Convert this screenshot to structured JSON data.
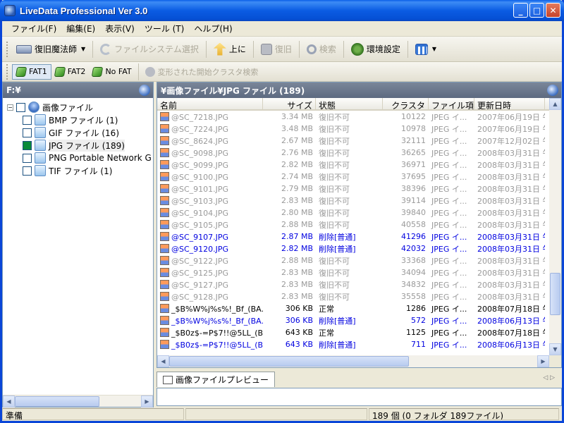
{
  "window": {
    "title": "LiveData Professional Ver 3.0"
  },
  "menu": [
    "ファイル(F)",
    "編集(E)",
    "表示(V)",
    "ツール (T)",
    "ヘルプ(H)"
  ],
  "toolbar1": {
    "restore_wizard": "復旧魔法師",
    "fs_select": "ファイルシステム選択",
    "up": "上に",
    "restore": "復旧",
    "search": "検索",
    "settings": "環境設定"
  },
  "toolbar2": {
    "fat1": "FAT1",
    "fat2": "FAT2",
    "nofat": "No FAT",
    "cluster_search": "変形された開始クラスタ検索"
  },
  "left": {
    "header": "F:¥",
    "root": "画像ファイル",
    "items": [
      "BMP ファイル (1)",
      "GIF ファイル (16)",
      "JPG ファイル (189)",
      "PNG Portable Network G",
      "TIF ファイル (1)"
    ]
  },
  "right": {
    "header": "¥画像ファイル¥JPG ファイル (189)",
    "columns": [
      "名前",
      "サイズ",
      "状態",
      "クラスタ",
      "ファイル項...",
      "更新日時"
    ],
    "rows": [
      {
        "name": "@SC_7218.JPG",
        "size": "3.34 MB",
        "state": "復旧不可",
        "cluster": "10122",
        "type": "JPEG イ...",
        "date": "2007年06月19日  午",
        "style": "gray"
      },
      {
        "name": "@SC_7224.JPG",
        "size": "3.48 MB",
        "state": "復旧不可",
        "cluster": "10978",
        "type": "JPEG イ...",
        "date": "2007年06月19日  午",
        "style": "gray"
      },
      {
        "name": "@SC_8624.JPG",
        "size": "2.67 MB",
        "state": "復旧不可",
        "cluster": "32111",
        "type": "JPEG イ...",
        "date": "2007年12月02日  午",
        "style": "gray"
      },
      {
        "name": "@SC_9098.JPG",
        "size": "2.76 MB",
        "state": "復旧不可",
        "cluster": "36265",
        "type": "JPEG イ...",
        "date": "2008年03月31日  午",
        "style": "gray"
      },
      {
        "name": "@SC_9099.JPG",
        "size": "2.82 MB",
        "state": "復旧不可",
        "cluster": "36971",
        "type": "JPEG イ...",
        "date": "2008年03月31日  午",
        "style": "gray"
      },
      {
        "name": "@SC_9100.JPG",
        "size": "2.74 MB",
        "state": "復旧不可",
        "cluster": "37695",
        "type": "JPEG イ...",
        "date": "2008年03月31日  午",
        "style": "gray"
      },
      {
        "name": "@SC_9101.JPG",
        "size": "2.79 MB",
        "state": "復旧不可",
        "cluster": "38396",
        "type": "JPEG イ...",
        "date": "2008年03月31日  午",
        "style": "gray"
      },
      {
        "name": "@SC_9103.JPG",
        "size": "2.83 MB",
        "state": "復旧不可",
        "cluster": "39114",
        "type": "JPEG イ...",
        "date": "2008年03月31日  午",
        "style": "gray"
      },
      {
        "name": "@SC_9104.JPG",
        "size": "2.80 MB",
        "state": "復旧不可",
        "cluster": "39840",
        "type": "JPEG イ...",
        "date": "2008年03月31日  午",
        "style": "gray"
      },
      {
        "name": "@SC_9105.JPG",
        "size": "2.88 MB",
        "state": "復旧不可",
        "cluster": "40558",
        "type": "JPEG イ...",
        "date": "2008年03月31日  午",
        "style": "gray"
      },
      {
        "name": "@SC_9107.JPG",
        "size": "2.87 MB",
        "state": "削除[普通]",
        "cluster": "41296",
        "type": "JPEG イ...",
        "date": "2008年03月31日  午",
        "style": "blue"
      },
      {
        "name": "@SC_9120.JPG",
        "size": "2.82 MB",
        "state": "削除[普通]",
        "cluster": "42032",
        "type": "JPEG イ...",
        "date": "2008年03月31日  午",
        "style": "blue"
      },
      {
        "name": "@SC_9122.JPG",
        "size": "2.88 MB",
        "state": "復旧不可",
        "cluster": "33368",
        "type": "JPEG イ...",
        "date": "2008年03月31日  午",
        "style": "gray"
      },
      {
        "name": "@SC_9125.JPG",
        "size": "2.83 MB",
        "state": "復旧不可",
        "cluster": "34094",
        "type": "JPEG イ...",
        "date": "2008年03月31日  午",
        "style": "gray"
      },
      {
        "name": "@SC_9127.JPG",
        "size": "2.83 MB",
        "state": "復旧不可",
        "cluster": "34832",
        "type": "JPEG イ...",
        "date": "2008年03月31日  午",
        "style": "gray"
      },
      {
        "name": "@SC_9128.JPG",
        "size": "2.83 MB",
        "state": "復旧不可",
        "cluster": "35558",
        "type": "JPEG イ...",
        "date": "2008年03月31日  午",
        "style": "gray"
      },
      {
        "name": "_$B%W%j%s%!_Bf_(BA.jpg",
        "size": "306 KB",
        "state": "正常",
        "cluster": "1286",
        "type": "JPEG イ...",
        "date": "2008年07月18日  午",
        "style": "black"
      },
      {
        "name": "_$B%W%j%s%!_Bf_(BA.jpg",
        "size": "306 KB",
        "state": "削除[普通]",
        "cluster": "572",
        "type": "JPEG イ...",
        "date": "2008年06月13日  午",
        "style": "blue"
      },
      {
        "name": "_$B0z$-=P$7!!@5LL_(BA.j...",
        "size": "643 KB",
        "state": "正常",
        "cluster": "1125",
        "type": "JPEG イ...",
        "date": "2008年07月18日  午",
        "style": "black"
      },
      {
        "name": "_$B0z$-=P$7!!@5LL_(BA.j...",
        "size": "643 KB",
        "state": "削除[普通]",
        "cluster": "711",
        "type": "JPEG イ...",
        "date": "2008年06月13日  午",
        "style": "blue"
      }
    ]
  },
  "preview": {
    "tab": "画像ファイルプレビュー"
  },
  "status": {
    "ready": "準備",
    "count": "189 個 (0 フォルダ 189ファイル)"
  }
}
